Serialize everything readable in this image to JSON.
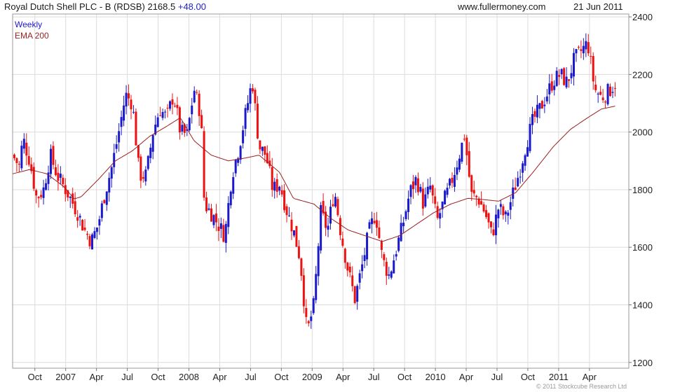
{
  "header": {
    "title": "Royal Dutch Shell PLC - B (RDSB)",
    "price": "2168.5",
    "change": "+48.00",
    "website": "www.fullermoney.com",
    "date": "21 Jun 2011"
  },
  "copyright": "© 2011 Stockcube Research Ltd",
  "colors": {
    "up": "#1a1acc",
    "down": "#ee1111",
    "ema": "#9c1f1f",
    "grid": "#dcdcdc"
  },
  "chart_data": {
    "type": "candlestick",
    "frequency_label": "Weekly",
    "indicator_label": "EMA 200",
    "y_ticks": [
      1200,
      1400,
      1600,
      1800,
      2000,
      2200,
      2400
    ],
    "ylim": [
      1180,
      2410
    ],
    "x_ticks": [
      "Oct",
      "2007",
      "Apr",
      "Jul",
      "Oct",
      "2008",
      "Apr",
      "Jul",
      "Oct",
      "2009",
      "Apr",
      "Jul",
      "Oct",
      "2010",
      "Apr",
      "Jul",
      "Oct",
      "2011",
      "Apr"
    ],
    "x_tick_positions": [
      0.065,
      0.155,
      0.245,
      0.335,
      0.425,
      0.515,
      0.605,
      0.695,
      0.785,
      0.875,
      0.965,
      1.055,
      1.145,
      1.235,
      1.325,
      1.415,
      1.505,
      1.595,
      1.685
    ],
    "xlim": [
      0.0,
      1.8
    ],
    "close_anchors": [
      [
        0.0,
        1920
      ],
      [
        0.02,
        1880
      ],
      [
        0.03,
        1980
      ],
      [
        0.05,
        1900
      ],
      [
        0.07,
        1770
      ],
      [
        0.09,
        1800
      ],
      [
        0.11,
        1920
      ],
      [
        0.13,
        1850
      ],
      [
        0.16,
        1790
      ],
      [
        0.19,
        1720
      ],
      [
        0.21,
        1660
      ],
      [
        0.23,
        1620
      ],
      [
        0.25,
        1680
      ],
      [
        0.27,
        1790
      ],
      [
        0.29,
        1880
      ],
      [
        0.31,
        2000
      ],
      [
        0.33,
        2130
      ],
      [
        0.35,
        2100
      ],
      [
        0.37,
        1850
      ],
      [
        0.39,
        1850
      ],
      [
        0.41,
        2000
      ],
      [
        0.43,
        2080
      ],
      [
        0.45,
        2050
      ],
      [
        0.47,
        2130
      ],
      [
        0.49,
        2000
      ],
      [
        0.51,
        1990
      ],
      [
        0.53,
        2150
      ],
      [
        0.55,
        2060
      ],
      [
        0.56,
        1750
      ],
      [
        0.58,
        1720
      ],
      [
        0.6,
        1680
      ],
      [
        0.62,
        1640
      ],
      [
        0.64,
        1850
      ],
      [
        0.66,
        1940
      ],
      [
        0.68,
        2060
      ],
      [
        0.7,
        2180
      ],
      [
        0.72,
        1950
      ],
      [
        0.74,
        1920
      ],
      [
        0.76,
        1800
      ],
      [
        0.78,
        1820
      ],
      [
        0.8,
        1730
      ],
      [
        0.82,
        1660
      ],
      [
        0.84,
        1560
      ],
      [
        0.86,
        1300
      ],
      [
        0.88,
        1400
      ],
      [
        0.9,
        1720
      ],
      [
        0.92,
        1660
      ],
      [
        0.94,
        1800
      ],
      [
        0.96,
        1640
      ],
      [
        0.98,
        1520
      ],
      [
        1.0,
        1420
      ],
      [
        1.02,
        1530
      ],
      [
        1.04,
        1650
      ],
      [
        1.06,
        1720
      ],
      [
        1.08,
        1560
      ],
      [
        1.1,
        1500
      ],
      [
        1.12,
        1590
      ],
      [
        1.14,
        1680
      ],
      [
        1.16,
        1790
      ],
      [
        1.18,
        1840
      ],
      [
        1.2,
        1750
      ],
      [
        1.22,
        1810
      ],
      [
        1.24,
        1690
      ],
      [
        1.26,
        1760
      ],
      [
        1.28,
        1820
      ],
      [
        1.3,
        1900
      ],
      [
        1.32,
        1990
      ],
      [
        1.34,
        1780
      ],
      [
        1.36,
        1770
      ],
      [
        1.38,
        1720
      ],
      [
        1.4,
        1640
      ],
      [
        1.42,
        1740
      ],
      [
        1.44,
        1700
      ],
      [
        1.46,
        1780
      ],
      [
        1.48,
        1860
      ],
      [
        1.5,
        1960
      ],
      [
        1.52,
        2040
      ],
      [
        1.54,
        2080
      ],
      [
        1.56,
        2130
      ],
      [
        1.58,
        2180
      ],
      [
        1.6,
        2200
      ],
      [
        1.62,
        2170
      ],
      [
        1.64,
        2250
      ],
      [
        1.66,
        2280
      ],
      [
        1.68,
        2310
      ],
      [
        1.7,
        2150
      ],
      [
        1.72,
        2120
      ],
      [
        1.74,
        2140
      ],
      [
        1.76,
        2168.5
      ]
    ],
    "ema_anchors": [
      [
        0.0,
        1855
      ],
      [
        0.05,
        1870
      ],
      [
        0.1,
        1855
      ],
      [
        0.15,
        1810
      ],
      [
        0.18,
        1768
      ],
      [
        0.2,
        1775
      ],
      [
        0.25,
        1835
      ],
      [
        0.3,
        1900
      ],
      [
        0.35,
        1935
      ],
      [
        0.4,
        1985
      ],
      [
        0.45,
        2020
      ],
      [
        0.49,
        2050
      ],
      [
        0.53,
        1970
      ],
      [
        0.58,
        1920
      ],
      [
        0.63,
        1900
      ],
      [
        0.68,
        1910
      ],
      [
        0.72,
        1920
      ],
      [
        0.78,
        1860
      ],
      [
        0.82,
        1770
      ],
      [
        0.88,
        1750
      ],
      [
        0.93,
        1700
      ],
      [
        0.98,
        1660
      ],
      [
        1.03,
        1640
      ],
      [
        1.08,
        1620
      ],
      [
        1.13,
        1640
      ],
      [
        1.18,
        1680
      ],
      [
        1.23,
        1720
      ],
      [
        1.28,
        1750
      ],
      [
        1.33,
        1770
      ],
      [
        1.38,
        1765
      ],
      [
        1.42,
        1760
      ],
      [
        1.47,
        1790
      ],
      [
        1.52,
        1860
      ],
      [
        1.58,
        1950
      ],
      [
        1.63,
        2010
      ],
      [
        1.68,
        2050
      ],
      [
        1.72,
        2080
      ],
      [
        1.76,
        2090
      ]
    ]
  }
}
